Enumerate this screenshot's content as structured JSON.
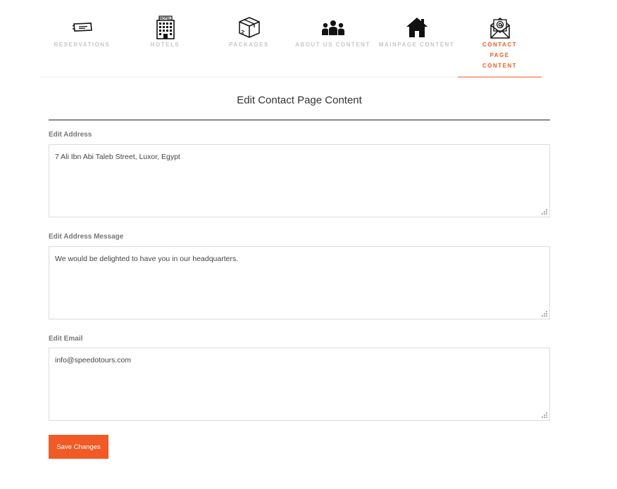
{
  "tabs": [
    {
      "label": "RESERVATIONS",
      "icon": "ticket-icon",
      "active": false
    },
    {
      "label": "HOTELS",
      "icon": "hotel-building-icon",
      "active": false
    },
    {
      "label": "PACKAGES",
      "icon": "package-box-icon",
      "active": false
    },
    {
      "label": "ABOUT US CONTENT",
      "icon": "people-group-icon",
      "active": false
    },
    {
      "label": "MAINPAGE CONTENT",
      "icon": "home-icon",
      "active": false
    },
    {
      "label": "CONTACT PAGE CONTENT",
      "icon": "mail-at-icon",
      "active": true
    }
  ],
  "page": {
    "title": "Edit Contact Page Content"
  },
  "fields": [
    {
      "label": "Edit Address",
      "value": "7 Ali Ibn Abi Taleb Street, Luxor, Egypt"
    },
    {
      "label": "Edit Address Message",
      "value": "We would be delighted to have you in our headquarters."
    },
    {
      "label": "Edit Email",
      "value": "info@speedotours.com"
    }
  ],
  "hotel_sign": "HOTEL",
  "save_label": "Save Changes",
  "colors": {
    "accent": "#f15a24",
    "inactive_label": "#c7c7c7"
  }
}
